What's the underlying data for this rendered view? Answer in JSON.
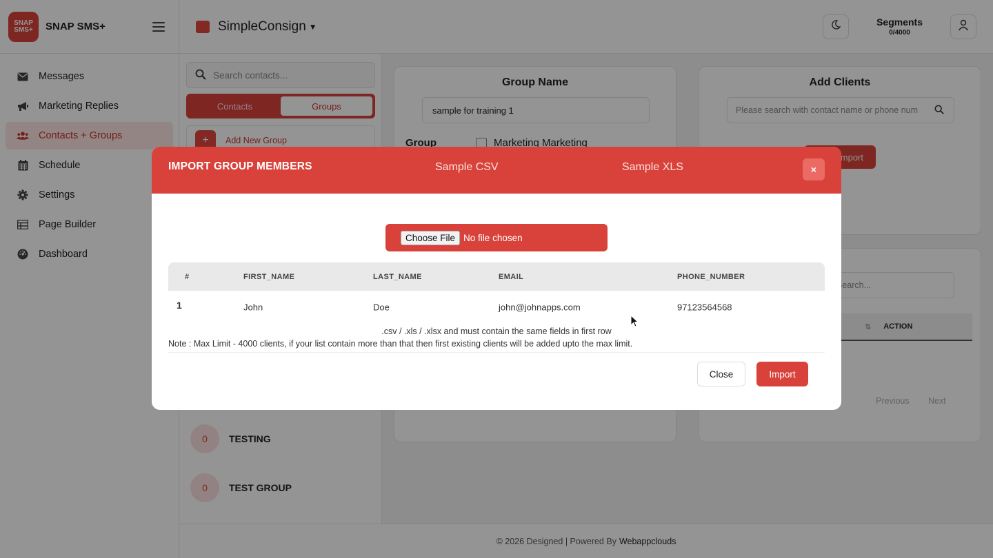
{
  "app": {
    "logo_line1": "SNAP",
    "logo_line2": "SMS+",
    "name": "SNAP SMS+"
  },
  "sidebar": {
    "items": [
      {
        "label": "Messages",
        "icon": "envelope-icon"
      },
      {
        "label": "Marketing Replies",
        "icon": "megaphone-icon"
      },
      {
        "label": "Contacts + Groups",
        "icon": "users-icon",
        "active": true
      },
      {
        "label": "Schedule",
        "icon": "calendar-icon"
      },
      {
        "label": "Settings",
        "icon": "gear-icon"
      },
      {
        "label": "Page Builder",
        "icon": "table-icon"
      },
      {
        "label": "Dashboard",
        "icon": "gauge-icon"
      }
    ]
  },
  "header": {
    "store_name": "SimpleConsign",
    "segments_label": "Segments",
    "segments_value": "0/4000"
  },
  "contacts_panel": {
    "search_placeholder": "Search contacts...",
    "tab_contacts": "Contacts",
    "tab_groups": "Groups",
    "add_group": "Add New Group",
    "groups": [
      {
        "count": "0",
        "name": "TESTING"
      },
      {
        "count": "0",
        "name": "TEST GROUP"
      }
    ]
  },
  "group_card": {
    "title": "Group Name",
    "name_value": "sample for training 1",
    "group_label": "Group",
    "checkbox_label": "Marketing Marketing"
  },
  "add_clients": {
    "title": "Add Clients",
    "search_placeholder": "Please search with contact name or phone num",
    "import_label": "Import"
  },
  "members_table": {
    "search_placeholder": "Search...",
    "action_header": "ACTION",
    "prev_label": "Previous",
    "next_label": "Next"
  },
  "footer": {
    "text": "© 2026 Designed | Powered By",
    "brand": "Webappclouds"
  },
  "modal": {
    "title": "IMPORT GROUP MEMBERS",
    "sample_csv": "Sample CSV",
    "sample_xls": "Sample XLS",
    "close_x": "×",
    "file_button": "Choose File",
    "file_status": "No file chosen",
    "columns": [
      "#",
      "FIRST_NAME",
      "LAST_NAME",
      "EMAIL",
      "PHONE_NUMBER"
    ],
    "rows": [
      {
        "num": "1",
        "first_name": "John",
        "last_name": "Doe",
        "email": "john@johnapps.com",
        "phone": "97123564568"
      }
    ],
    "note_formats": ".csv / .xls / .xlsx and must contain the same fields in first row",
    "note_limit": "Note : Max Limit - 4000 clients, if your list contain more than that then first existing clients will be added upto the max limit.",
    "close_button": "Close",
    "import_button": "Import"
  },
  "colors": {
    "accent": "#d9423a",
    "accent_light": "#fbe5e4"
  }
}
